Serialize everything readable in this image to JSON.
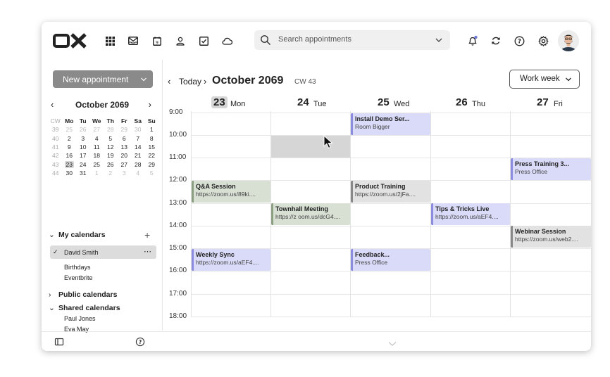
{
  "header": {
    "search_placeholder": "Search appointments",
    "app_icons": [
      "apps-grid-icon",
      "mail-icon",
      "calendar-icon",
      "contacts-icon",
      "tasks-icon",
      "cloud-icon"
    ],
    "right_icons": [
      "notification-bell-icon",
      "refresh-icon",
      "help-icon",
      "settings-gear-icon"
    ]
  },
  "sidebar": {
    "new_appointment": "New appointment",
    "mini_calendar": {
      "title": "October 2069",
      "prev": "‹",
      "next": "›",
      "headers": [
        "CW",
        "Mo",
        "Tu",
        "We",
        "Th",
        "Fr",
        "Sa",
        "Su"
      ],
      "weeks": [
        [
          "39",
          "25",
          "26",
          "27",
          "28",
          "29",
          "30",
          "1"
        ],
        [
          "40",
          "2",
          "3",
          "4",
          "5",
          "6",
          "7",
          "8"
        ],
        [
          "41",
          "9",
          "10",
          "11",
          "12",
          "13",
          "14",
          "15"
        ],
        [
          "42",
          "16",
          "17",
          "18",
          "19",
          "20",
          "21",
          "22"
        ],
        [
          "43",
          "23",
          "24",
          "25",
          "26",
          "27",
          "28",
          "29"
        ],
        [
          "44",
          "30",
          "31",
          "1",
          "2",
          "3",
          "4",
          "5"
        ]
      ]
    },
    "my_calendars": "My calendars",
    "my_calendar_items": [
      "David Smith"
    ],
    "sub_items": [
      "Birthdays",
      "Eventbrite"
    ],
    "public_calendars": "Public calendars",
    "shared_calendars": "Shared calendars",
    "shared_items": [
      "Paul Jones",
      "Eva May"
    ]
  },
  "toolbar": {
    "today": "Today",
    "month": "October 2069",
    "cw": "CW 43",
    "view": "Work week"
  },
  "days": [
    {
      "num": "23",
      "name": "Mon",
      "today": true
    },
    {
      "num": "24",
      "name": "Tue"
    },
    {
      "num": "25",
      "name": "Wed"
    },
    {
      "num": "26",
      "name": "Thu"
    },
    {
      "num": "27",
      "name": "Fri"
    }
  ],
  "times": [
    "9:00",
    "10:00",
    "11:00",
    "12:00",
    "13:00",
    "14:00",
    "15:00",
    "16:00",
    "17:00",
    "18:00"
  ],
  "events": [
    {
      "title": "Install Demo Ser...",
      "detail": "Room Bigger"
    },
    {
      "title": "Press Training 3...",
      "detail": "Press Office"
    },
    {
      "title": "Q&A Session",
      "detail": "https://zoom.us/89ki...."
    },
    {
      "title": "Product Training",
      "detail": "https://zoom.us/2jFa...."
    },
    {
      "title": "Townhall Meeting",
      "detail": "https://z oom.us/dcG4...."
    },
    {
      "title": "Tips & Tricks Live",
      "detail": "https://zoom.us/aEF4...."
    },
    {
      "title": "Webinar Session",
      "detail": "https://zoom.us/web2...."
    },
    {
      "title": "Weekly Sync",
      "detail": "https://zoom.us/aEF4...."
    },
    {
      "title": "Feedback...",
      "detail": "Press Office"
    }
  ],
  "colors": {
    "accent_purple": "#d9dbf8",
    "accent_green": "#d8e0d4",
    "accent_gray": "#e2e2e2",
    "button_gray": "#8a8a8a"
  }
}
